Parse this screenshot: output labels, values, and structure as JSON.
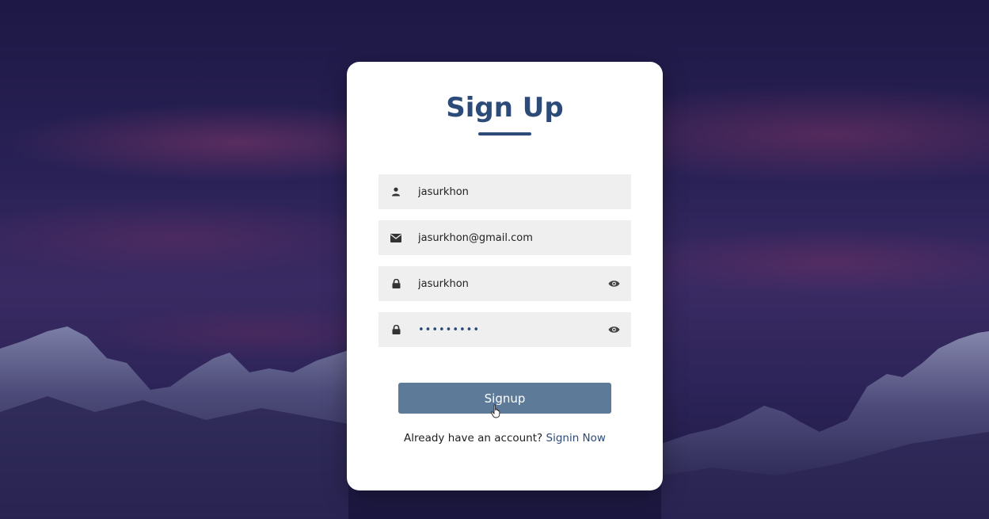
{
  "form": {
    "title": "Sign Up",
    "fields": [
      {
        "name": "username",
        "icon": "user-icon",
        "value": "jasurkhon"
      },
      {
        "name": "email",
        "icon": "envelope-icon",
        "value": "jasurkhon@gmail.com"
      },
      {
        "name": "password",
        "icon": "lock-icon",
        "value": "jasurkhon",
        "toggle_icon": "eye-icon"
      },
      {
        "name": "confirm_password",
        "icon": "lock-icon",
        "value": "•••••••••",
        "toggle_icon": "eye-icon"
      }
    ],
    "submit_label": "Signup",
    "signin_prompt": "Already have an account?",
    "signin_link": "Signin Now"
  },
  "colors": {
    "accent": "#2d4b78",
    "button": "#5d7a99",
    "field_bg": "#efefef"
  }
}
